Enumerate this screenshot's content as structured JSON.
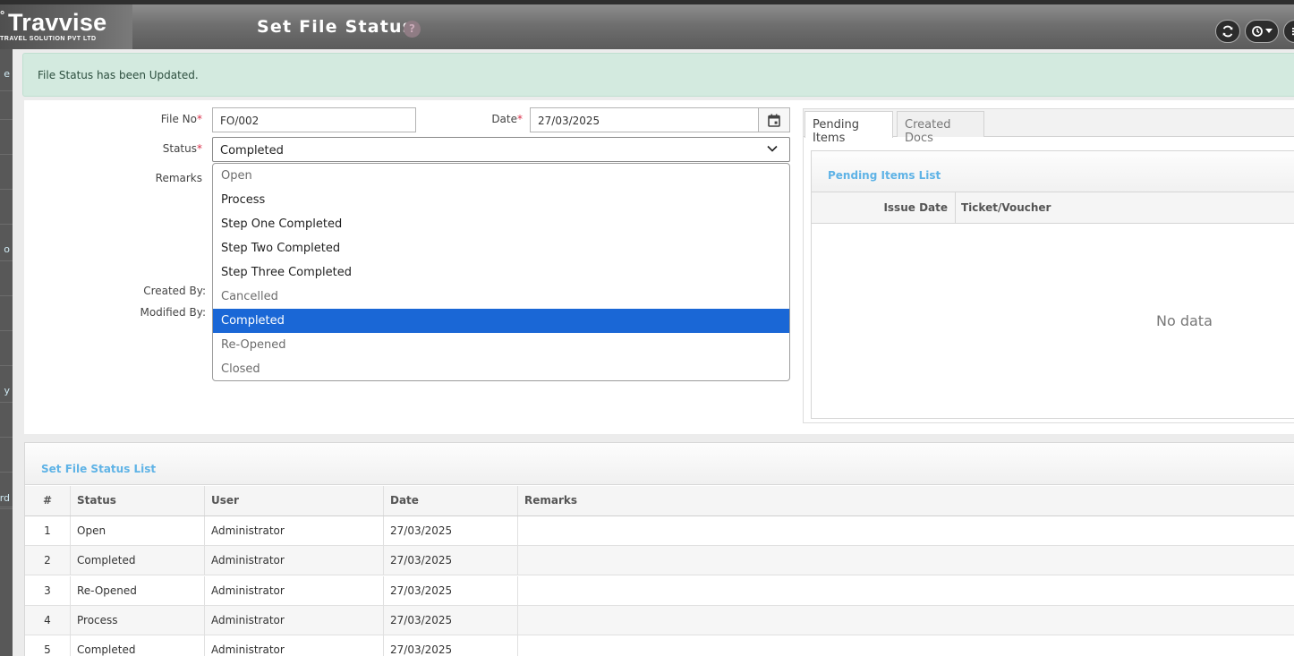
{
  "app": {
    "logo_mark": "°",
    "logo_name": "Travvise",
    "logo_sub": "TRAVEL SOLUTION PVT LTD",
    "page_title": "Set File Status",
    "help_glyph": "?"
  },
  "leftnav": {
    "items": [
      "e",
      "",
      "",
      "",
      "",
      "o",
      "",
      "",
      "",
      "y",
      "",
      "",
      "",
      "rd"
    ]
  },
  "alert": {
    "message": "File Status has been Updated."
  },
  "form": {
    "file_no_label": "File No",
    "file_no_value": "FO/002",
    "date_label": "Date",
    "date_value": "27/03/2025",
    "status_label": "Status",
    "status_value": "Completed",
    "remarks_label": "Remarks",
    "created_by_label": "Created By:",
    "modified_by_label": "Modified By:",
    "required_mark": "*",
    "status_options": [
      {
        "label": "Open",
        "state": "dim"
      },
      {
        "label": "Process",
        "state": "normal"
      },
      {
        "label": "Step One Completed",
        "state": "normal"
      },
      {
        "label": "Step Two Completed",
        "state": "normal"
      },
      {
        "label": "Step Three Completed",
        "state": "normal"
      },
      {
        "label": "Cancelled",
        "state": "dim"
      },
      {
        "label": "Completed",
        "state": "selected"
      },
      {
        "label": "Re-Opened",
        "state": "dim"
      },
      {
        "label": "Closed",
        "state": "dim"
      }
    ]
  },
  "tabs": {
    "pending_label": "Pending Items",
    "docs_label": "Created Docs",
    "pending_title": "Pending Items List",
    "col_issue_date": "Issue Date",
    "col_ticket": "Ticket/Voucher",
    "empty_text": "No data"
  },
  "list": {
    "title": "Set File Status List",
    "columns": [
      "#",
      "Status",
      "User",
      "Date",
      "Remarks"
    ],
    "rows": [
      {
        "num": "1",
        "status": "Open",
        "user": "Administrator",
        "date": "27/03/2025",
        "remarks": ""
      },
      {
        "num": "2",
        "status": "Completed",
        "user": "Administrator",
        "date": "27/03/2025",
        "remarks": ""
      },
      {
        "num": "3",
        "status": "Re-Opened",
        "user": "Administrator",
        "date": "27/03/2025",
        "remarks": ""
      },
      {
        "num": "4",
        "status": "Process",
        "user": "Administrator",
        "date": "27/03/2025",
        "remarks": ""
      },
      {
        "num": "5",
        "status": "Completed",
        "user": "Administrator",
        "date": "27/03/2025",
        "remarks": ""
      }
    ]
  },
  "colors": {
    "accent_blue": "#5fb3e6",
    "selected_option": "#1a67d6",
    "alert_bg": "#d3eadf",
    "required": "#d9304a"
  },
  "icons": {
    "refresh": "refresh-icon",
    "history": "history-icon",
    "menu": "menu-icon",
    "calendar": "calendar-icon",
    "dropdown": "chevron-down-icon"
  }
}
